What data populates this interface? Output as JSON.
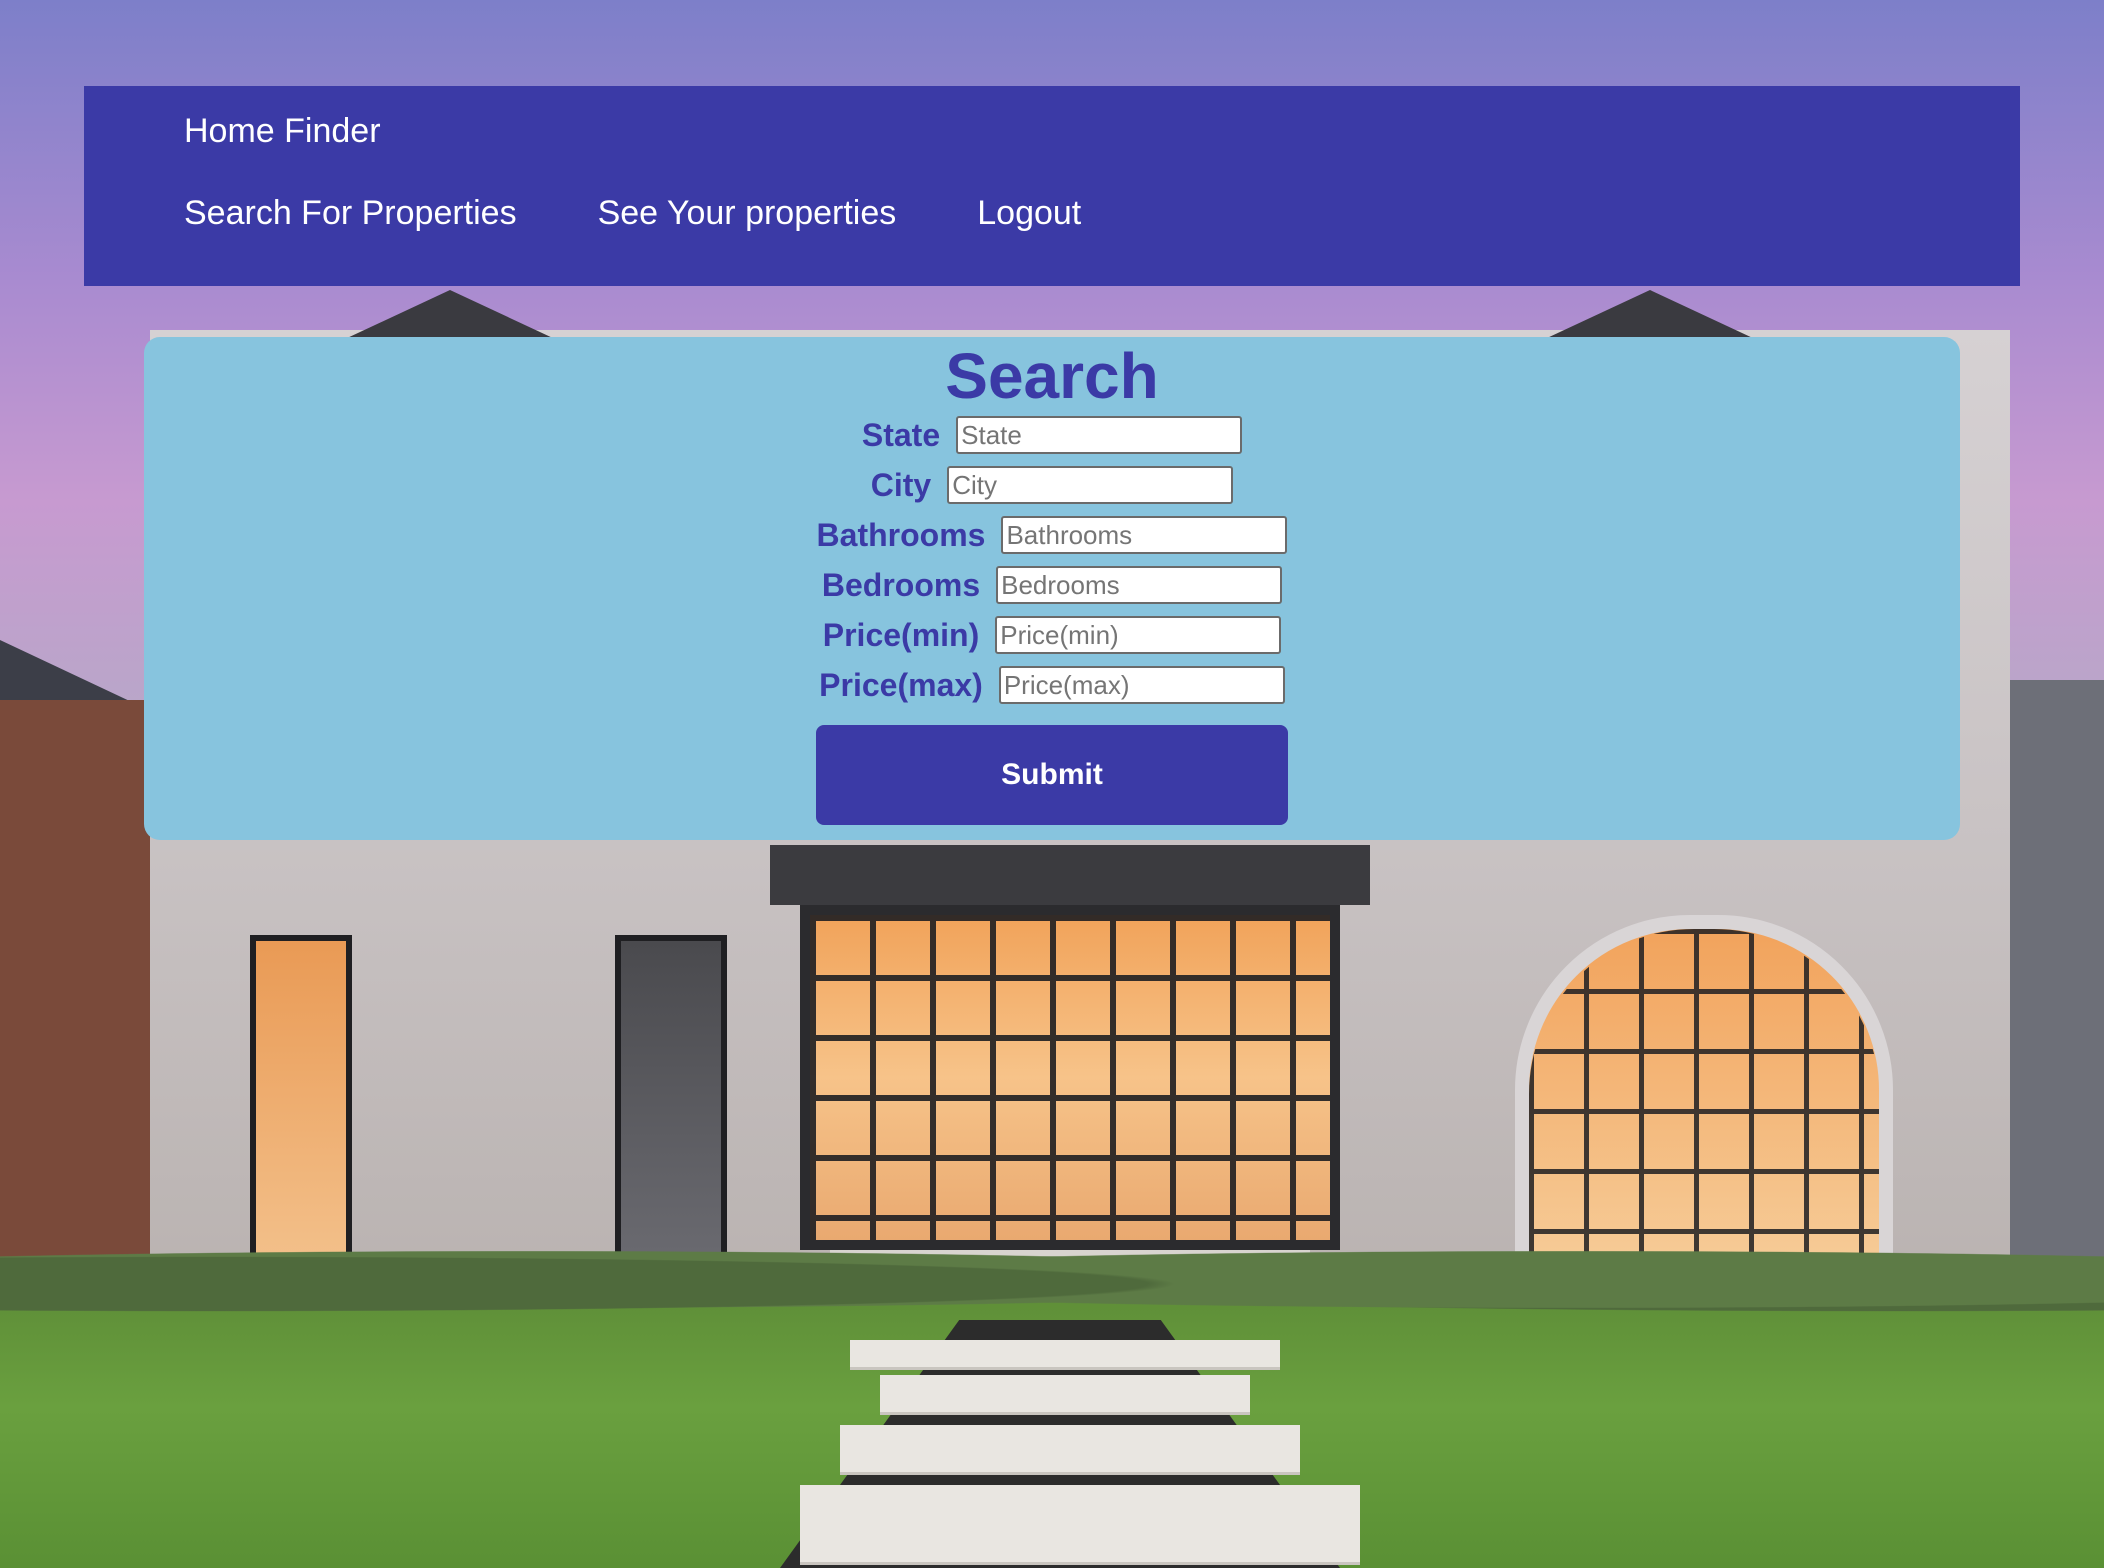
{
  "navbar": {
    "brand": "Home Finder",
    "links": [
      {
        "label": "Search For Properties"
      },
      {
        "label": "See Your properties"
      },
      {
        "label": "Logout"
      }
    ],
    "background_color": "#3b3aa6"
  },
  "search": {
    "title": "Search",
    "card_color": "#87c4de",
    "accent_color": "#3b3aa6",
    "fields": [
      {
        "label": "State",
        "placeholder": "State",
        "value": ""
      },
      {
        "label": "City",
        "placeholder": "City",
        "value": ""
      },
      {
        "label": "Bathrooms",
        "placeholder": "Bathrooms",
        "value": ""
      },
      {
        "label": "Bedrooms",
        "placeholder": "Bedrooms",
        "value": ""
      },
      {
        "label": "Price(min)",
        "placeholder": "Price(min)",
        "value": ""
      },
      {
        "label": "Price(max)",
        "placeholder": "Price(max)",
        "value": ""
      }
    ],
    "submit_label": "Submit"
  },
  "background": {
    "icon": "house-photo"
  }
}
